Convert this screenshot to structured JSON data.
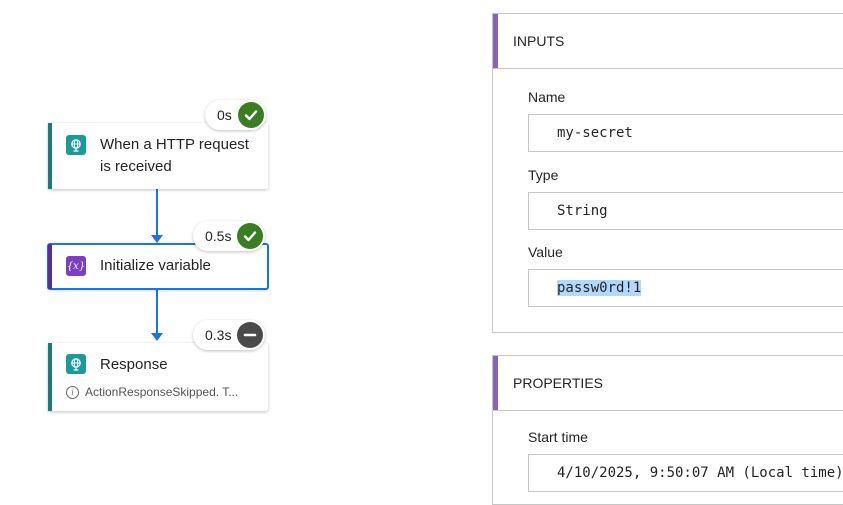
{
  "flow": {
    "steps": [
      {
        "title": "When a HTTP request is received",
        "duration": "0s",
        "status": "succeeded",
        "icon": "http-globe-icon",
        "accent": "#1b7b7b"
      },
      {
        "title": "Initialize variable",
        "duration": "0.5s",
        "status": "succeeded",
        "icon": "variable-icon",
        "accent": "#5c2e91"
      },
      {
        "title": "Response",
        "duration": "0.3s",
        "status": "skipped",
        "icon": "http-globe-icon",
        "accent": "#1b7b7b",
        "subtitle": "ActionResponseSkipped. T..."
      }
    ],
    "variable_glyph": "{x}"
  },
  "inputs": {
    "header": "INPUTS",
    "fields": [
      {
        "label": "Name",
        "value": "my-secret"
      },
      {
        "label": "Type",
        "value": "String"
      },
      {
        "label": "Value",
        "value": "passw0rd!1"
      }
    ]
  },
  "properties": {
    "header": "PROPERTIES",
    "fields": [
      {
        "label": "Start time",
        "value": "4/10/2025, 9:50:07 AM (Local time)"
      }
    ]
  },
  "colors": {
    "connector": "#1a73e8",
    "success": "#3a7d22",
    "skipped": "#4a4a4a",
    "panel_accent": "#8764b8",
    "selection": "#b3d7ff"
  }
}
